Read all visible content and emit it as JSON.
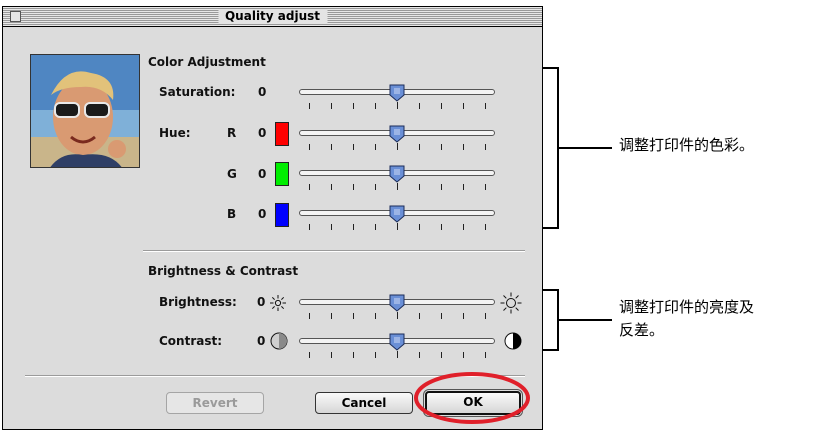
{
  "dialog": {
    "title": "Quality adjust",
    "color_section": {
      "heading": "Color Adjustment",
      "saturation": {
        "label": "Saturation:",
        "value": "0"
      },
      "hue": {
        "label": "Hue:",
        "channels": [
          {
            "label": "R",
            "value": "0",
            "color": "#ff0000"
          },
          {
            "label": "G",
            "value": "0",
            "color": "#00ee00"
          },
          {
            "label": "B",
            "value": "0",
            "color": "#0000ff"
          }
        ]
      }
    },
    "brightness_section": {
      "heading": "Brightness & Contrast",
      "brightness": {
        "label": "Brightness:",
        "value": "0"
      },
      "contrast": {
        "label": "Contrast:",
        "value": "0"
      }
    },
    "buttons": {
      "revert": "Revert",
      "cancel": "Cancel",
      "ok": "OK"
    },
    "slider_position": 0.5
  },
  "annotations": {
    "color_note": "调整打印件的色彩。",
    "brightness_note_line1": "调整打印件的亮度及",
    "brightness_note_line2": "反差。"
  },
  "colors": {
    "thumb": "#6a8fd6",
    "highlight_circle": "#e0202a"
  }
}
